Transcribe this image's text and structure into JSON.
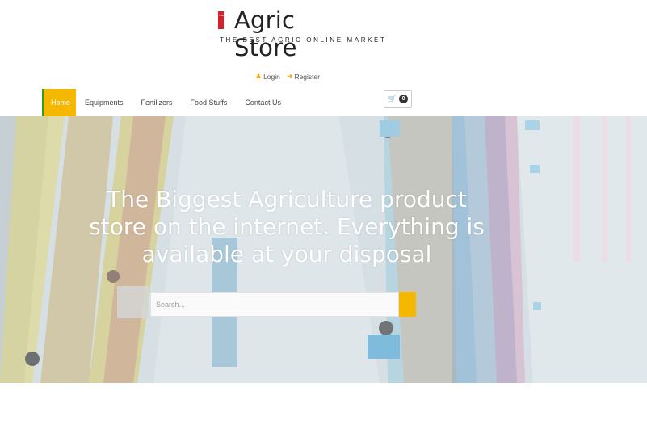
{
  "brand": {
    "mark_text": "THE",
    "title": "Agric Store",
    "tagline": "THE BEST AGRIC ONLINE MARKET",
    "mark_color": "#d6212b"
  },
  "account": {
    "login_label": "Login",
    "register_label": "Register",
    "icon_color": "#f0a500"
  },
  "nav": {
    "items": [
      {
        "label": "Home"
      },
      {
        "label": "Equipments"
      },
      {
        "label": "Fertilizers"
      },
      {
        "label": "Food Stuffs"
      },
      {
        "label": "Contact Us"
      }
    ],
    "active_color": "#f5b800"
  },
  "cart": {
    "count": "0"
  },
  "hero": {
    "title": "The Biggest Agriculture product store on the internet. Everything is available at your disposal"
  },
  "search": {
    "placeholder": "Search..."
  }
}
